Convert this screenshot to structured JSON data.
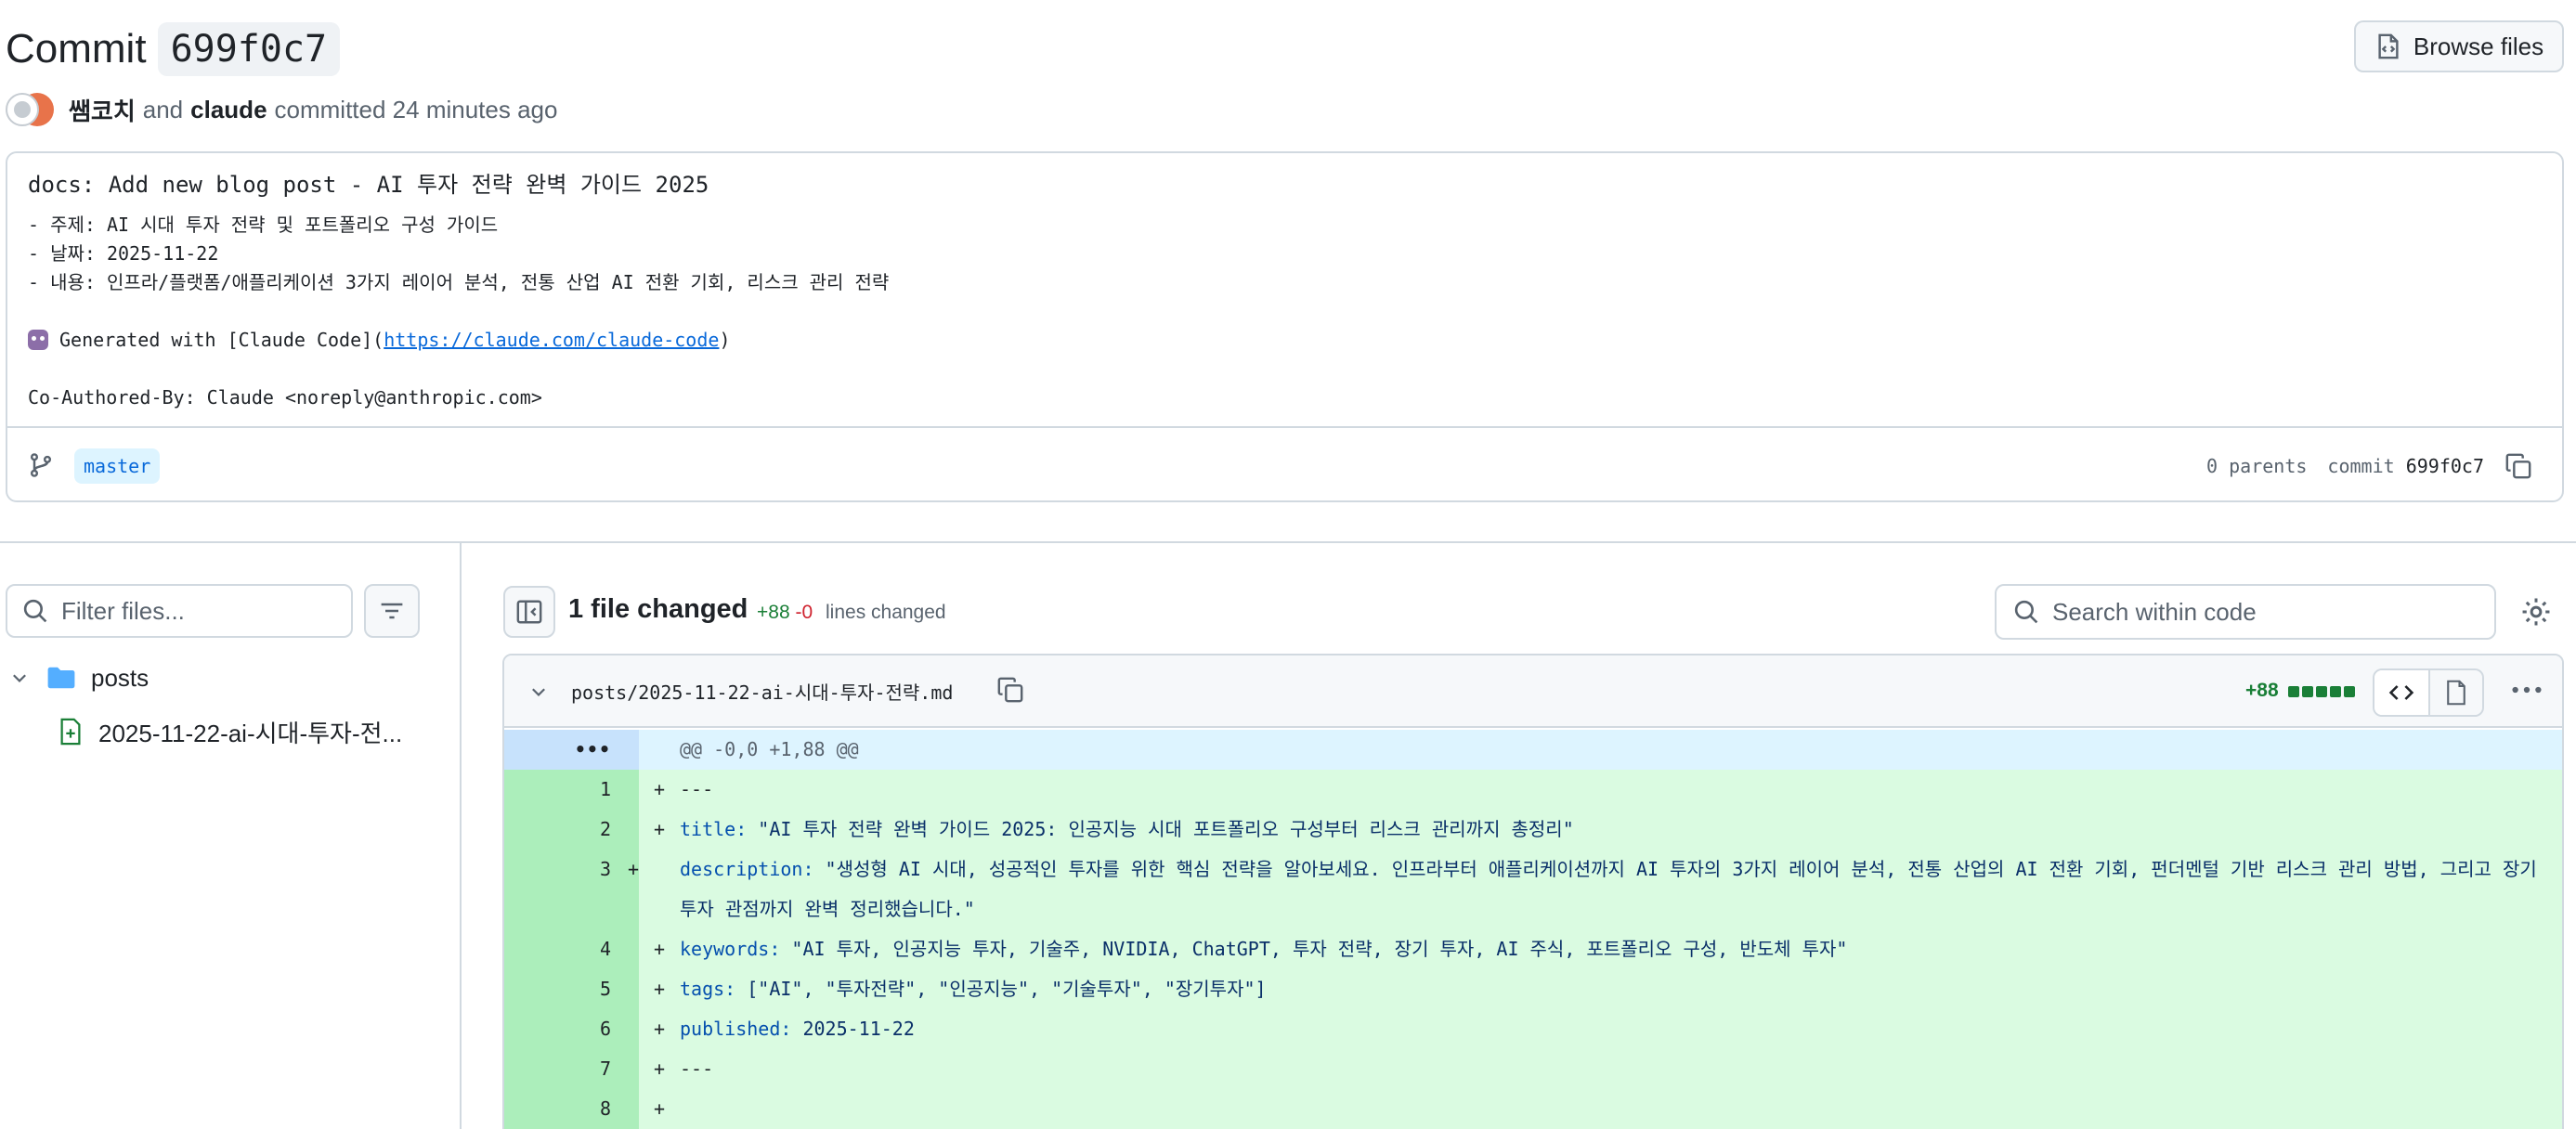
{
  "header": {
    "title": "Commit",
    "sha": "699f0c7",
    "browse_files_label": "Browse files"
  },
  "authors": {
    "author1": "쌤코치",
    "and": "and",
    "author2": "claude",
    "action": "committed 24 minutes ago"
  },
  "message": {
    "title": "docs: Add new blog post - AI 투자 전략 완벽 가이드 2025",
    "line1": "- 주제: AI 시대 투자 전략 및 포트폴리오 구성 가이드",
    "line2": "- 날짜: 2025-11-22",
    "line3": "- 내용: 인프라/플랫폼/애플리케이션 3가지 레이어 분석, 전통 산업 AI 전환 기회, 리스크 관리 전략",
    "generated_prefix": "Generated with [Claude Code](",
    "generated_link": "https://claude.com/claude-code",
    "generated_suffix": ")",
    "coauthor": "Co-Authored-By: Claude <noreply@anthropic.com>",
    "branch": "master",
    "parents": "0 parents",
    "commit_label": "commit",
    "commit_sha": "699f0c7"
  },
  "file_tree": {
    "filter_placeholder": "Filter files...",
    "folder": "posts",
    "file": "2025-11-22-ai-시대-투자-전..."
  },
  "diff_toolbar": {
    "files_changed": "1 file changed",
    "additions": "+88",
    "deletions": "-0",
    "lines_changed": "lines changed",
    "search_placeholder": "Search within code"
  },
  "diff_file": {
    "path": "posts/2025-11-22-ai-시대-투자-전략.md",
    "additions": "+88",
    "hunk_expander": "•••",
    "hunk_header": "@@ -0,0 +1,88 @@",
    "lines": [
      {
        "num": "1",
        "key": "",
        "value": "---"
      },
      {
        "num": "2",
        "key": "title:",
        "value": " \"AI 투자 전략 완벽 가이드 2025: 인공지능 시대 포트폴리오 구성부터 리스크 관리까지 총정리\""
      },
      {
        "num": "3",
        "key": "description:",
        "value": " \"생성형 AI 시대, 성공적인 투자를 위한 핵심 전략을 알아보세요. 인프라부터 애플리케이션까지 AI 투자의 3가지 레이어 분석, 전통 산업의 AI 전환 기회, 펀더멘털 기반 리스크 관리 방법, 그리고 장기 투자 관점까지 완벽 정리했습니다.\""
      },
      {
        "num": "4",
        "key": "keywords:",
        "value": " \"AI 투자, 인공지능 투자, 기술주, NVIDIA, ChatGPT, 투자 전략, 장기 투자, AI 주식, 포트폴리오 구성, 반도체 투자\""
      },
      {
        "num": "5",
        "key": "tags:",
        "value": " [\"AI\", \"투자전략\", \"인공지능\", \"기술투자\", \"장기투자\"]"
      },
      {
        "num": "6",
        "key": "published:",
        "value": " 2025-11-22"
      },
      {
        "num": "7",
        "key": "",
        "value": "---"
      },
      {
        "num": "8",
        "key": "",
        "value": ""
      }
    ]
  },
  "colors": {
    "addition_green": "#1a7f37",
    "deletion_red": "#cf222e",
    "link_blue": "#0969da",
    "added_line_bg": "#dafbe1",
    "added_gutter_bg": "#aceebb",
    "hunk_bg": "#ddf4ff"
  },
  "icons": {
    "browse": "file-code-icon",
    "branch": "git-branch-icon",
    "copy": "copy-icon",
    "search": "search-icon",
    "filter": "filter-icon",
    "folder": "folder-icon",
    "file_added": "file-added-icon",
    "collapse": "sidebar-collapse-icon",
    "gear": "gear-icon",
    "chevron": "chevron-down-icon",
    "code_view": "code-icon",
    "file_view": "file-icon",
    "more": "kebab-horizontal-icon"
  }
}
